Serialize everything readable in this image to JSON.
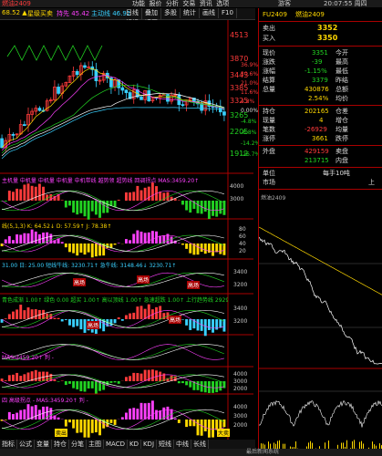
{
  "window": {
    "title": "燃油2409",
    "menu": [
      "功能",
      "报价",
      "分析",
      "交易",
      "资讯",
      "选项"
    ],
    "time": "20:07:55 周四",
    "user": "游客"
  },
  "toolbar": {
    "buttons": [
      "日线",
      "叠加",
      "多股",
      "统计",
      "画线",
      "F10",
      "标记",
      "返回"
    ],
    "info": [
      "主要开仓",
      "开始拉升",
      "积极进入"
    ],
    "ind_top": "68.52 ▲",
    "ind1": "星级买卖",
    "ind2": "持先 45.42",
    "ind3": "主动线 46.92"
  },
  "axis": {
    "main": [
      "4513",
      "3870",
      "3443",
      "3385",
      "3325",
      "3265",
      "2205",
      "1912"
    ],
    "right_pct": [
      "36.9%",
      "30.6%",
      "21.0%",
      "11.6%",
      "4.8%",
      "0.00%",
      "-4.8%",
      "-8.8%",
      "-14.2%",
      "-26.7%"
    ],
    "sub1": [
      "4000",
      "3000"
    ],
    "sub2": [
      "80",
      "60",
      "40",
      "20"
    ],
    "sub3": [
      "3400",
      "3200"
    ],
    "sub4": [
      "3400",
      "3200"
    ],
    "sub5": [
      "4000",
      "3000",
      "2000"
    ],
    "sub6": [
      "4000",
      "3000",
      "2000"
    ],
    "sub7": [
      "3400",
      "3300",
      "3200",
      "3100"
    ]
  },
  "sub_labels": {
    "s1": "主机量  中机量  中机量  中机量  中机带线  越势领  超势线  回调拐点  MAS:3459.20↑",
    "s2": "线(5,1,3) K: 64.52↓ D: 57.59↑ J: 78.38↑",
    "s3": "31.00 日: 25.00 短线牛线: 3230.71↑  急牛线: 3148.46↓  3230.71↑",
    "s4": "青色成渐 1.00↑  绿色 0.00  超买 1.00↑  高以顶线 1.00↑  急速超跌 1.00↑  上行趋势线 2929.05↑",
    "s5": "MAS:3459.20↑ 判 -",
    "s6": "四 高级拐点 - MAS:3459.20↑ 判 -",
    "s7": "MAS:3459.20↑",
    "chips": [
      "高场",
      "高场",
      "高场",
      "高场",
      "高场",
      "卖出",
      "大卖"
    ]
  },
  "quote": {
    "code": "FU2409",
    "name": "燃油2409",
    "sell_label": "卖出",
    "sell": "3352",
    "buy_label": "买入",
    "buy": "3350",
    "rows": [
      {
        "l": "现价",
        "v": "3351",
        "l2": "今开",
        "v2": ""
      },
      {
        "l": "涨跌",
        "v": "-39",
        "l2": "最高",
        "v2": ""
      },
      {
        "l": "涨幅",
        "v": "-1.15%",
        "l2": "最低",
        "v2": ""
      },
      {
        "l": "结算",
        "v": "3379",
        "l2": "昨结",
        "v2": ""
      },
      {
        "l": "总量",
        "v": "430876",
        "l2": "总额",
        "v2": ""
      },
      {
        "l": "",
        "v": "2.54%",
        "l2": "均价",
        "v2": ""
      }
    ],
    "rows2": [
      {
        "l": "持仓",
        "v": "202165",
        "l2": "仓差",
        "v2": ""
      },
      {
        "l": "现量",
        "v": "4",
        "l2": "增仓",
        "v2": ""
      },
      {
        "l": "笔数",
        "v": "-26929",
        "l2": "均量",
        "v2": ""
      },
      {
        "l": "涨停",
        "v": "3661",
        "l2": "跌停",
        "v2": ""
      }
    ],
    "rows3": [
      {
        "l": "外盘",
        "v": "429159",
        "l2": "卖盘",
        "v2": ""
      },
      {
        "l": "",
        "v": "213715",
        "l2": "内盘",
        "v2": ""
      }
    ],
    "unit_label": "单位",
    "unit_val": "每手10吨",
    "market_label": "市场",
    "market_val": "上",
    "mini_title": "燃油2409"
  },
  "bottom_tabs": [
    "指标",
    "公式",
    "变量",
    "持仓",
    "分笔",
    "主图",
    "MACD",
    "KD",
    "KDJ",
    "短线",
    "中线",
    "长线"
  ],
  "status": "最后新闻系统"
}
